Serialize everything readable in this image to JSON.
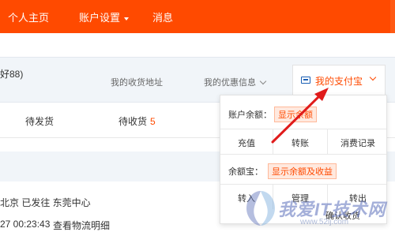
{
  "topnav": {
    "items": [
      {
        "label": "个人主页"
      },
      {
        "label": "账户设置",
        "has_caret": true
      },
      {
        "label": "消息"
      }
    ],
    "accent_color": "#ff4a00"
  },
  "info_row": {
    "level_text": "好88)",
    "links": [
      {
        "label": "我的收货地址"
      },
      {
        "label": "我的优惠信息"
      }
    ],
    "alipay_tab": {
      "label": "我的支付宝"
    }
  },
  "status_row": {
    "items": [
      {
        "label": "待发货"
      },
      {
        "label": "待收货",
        "count": "5"
      }
    ]
  },
  "dropdown": {
    "balance_label": "账户余额：",
    "balance_button": "显示余额",
    "actions1": [
      {
        "label": "充值"
      },
      {
        "label": "转账"
      },
      {
        "label": "消费记录"
      }
    ],
    "yuebao_label": "余额宝：",
    "yuebao_button": "显示余额及收益",
    "actions2": [
      {
        "label": "转入"
      },
      {
        "label": "管理"
      },
      {
        "label": "转出"
      }
    ]
  },
  "order": {
    "location": "北京 已发往 东莞中心",
    "time": "27 00:23:43",
    "track_link": "查看物流明细",
    "confirm_label": "确认收货"
  },
  "watermark": {
    "text": "我爱IT技术网",
    "url": "www.52ij.com"
  }
}
